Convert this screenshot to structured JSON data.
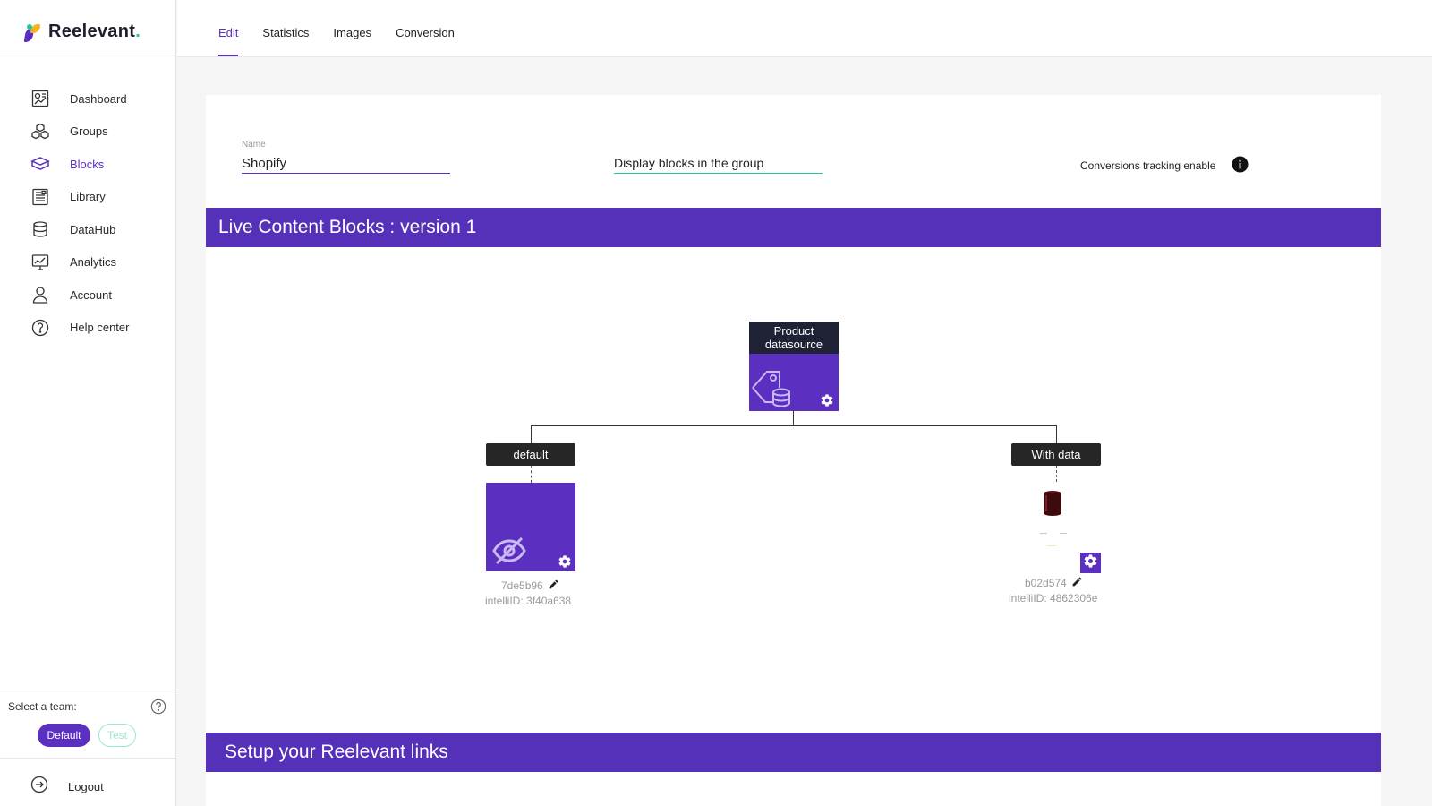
{
  "app": {
    "brand": "Reelevant",
    "brand_dot": "."
  },
  "sidebar": {
    "items": [
      {
        "label": "Dashboard",
        "icon": "dashboard-icon"
      },
      {
        "label": "Groups",
        "icon": "groups-icon"
      },
      {
        "label": "Blocks",
        "icon": "blocks-icon",
        "active": true
      },
      {
        "label": "Library",
        "icon": "library-icon"
      },
      {
        "label": "DataHub",
        "icon": "database-icon"
      },
      {
        "label": "Analytics",
        "icon": "analytics-icon"
      },
      {
        "label": "Account",
        "icon": "user-icon"
      },
      {
        "label": "Help center",
        "icon": "help-icon"
      }
    ],
    "team": {
      "label": "Select a team:",
      "options": [
        "Default",
        "Test"
      ],
      "selected": "Default"
    },
    "logout": "Logout"
  },
  "tabs": [
    {
      "label": "Edit",
      "active": true
    },
    {
      "label": "Statistics"
    },
    {
      "label": "Images"
    },
    {
      "label": "Conversion"
    }
  ],
  "form": {
    "name_label": "Name",
    "name_value": "Shopify",
    "display_select": "Display blocks in the group",
    "conversion_label": "Conversions tracking enable"
  },
  "section1": {
    "title": "Live Content Blocks : version 1"
  },
  "tree": {
    "root": {
      "label": "Product datasource"
    },
    "branches": [
      {
        "label": "default",
        "block_id": "7de5b96",
        "intelli_id": "intelliID: 3f40a638"
      },
      {
        "label": "With data",
        "block_id": "b02d574",
        "intelli_id": "intelliID: 4862306e"
      }
    ]
  },
  "section2": {
    "title": "Setup your Reelevant links"
  },
  "colors": {
    "accent": "#5b2fbf",
    "band": "#5530b8",
    "teal": "#27c49a",
    "dark": "#1f2235"
  }
}
